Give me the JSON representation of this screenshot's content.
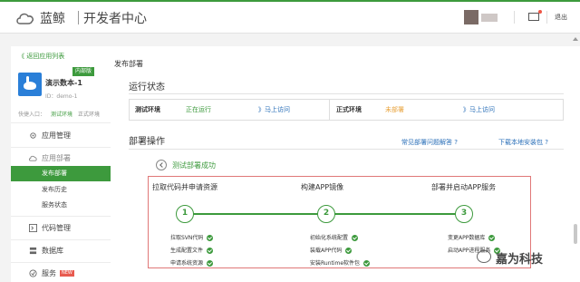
{
  "header": {
    "brand": "蓝鲸",
    "subtitle": "开发者中心",
    "logout": "退出",
    "icons": [
      "cloud-logo-icon",
      "avatar",
      "mail-icon"
    ]
  },
  "sidebar": {
    "back_link": "《 返回应用列表",
    "app": {
      "badge": "内部版",
      "name": "演示数本-1",
      "id": "ID：demo-1"
    },
    "quick_entry": {
      "label": "快捷入口：",
      "test_env": "测试环境",
      "prod_env": "正式环境"
    },
    "menu": {
      "app_manage": "应用管理",
      "app_deploy": "应用部署",
      "deploy_publish": "发布部署",
      "deploy_history": "发布历史",
      "service_status": "服务状态",
      "code_manage": "代码管理",
      "database": "数据库",
      "services": "服务",
      "new_badge": "NEW"
    }
  },
  "main": {
    "page_title": "发布部署",
    "run_status": {
      "title": "运行状态",
      "test_env_label": "测试环境",
      "test_env_status": "正在运行",
      "test_env_visit": "》马上访问",
      "prod_env_label": "正式环境",
      "prod_env_status": "未部署",
      "prod_env_visit": "》马上访问"
    },
    "deploy_ops": {
      "title": "部署操作",
      "faq_link": "常见部署问题解答 ?",
      "download_link": "下载本地安装包 ?",
      "success_msg": "测试部署成功"
    },
    "steps": [
      {
        "num": "1",
        "title": "拉取代码并申请资源",
        "tasks": [
          "拉取SVN代码",
          "生成配置文件",
          "申请系统资源"
        ]
      },
      {
        "num": "2",
        "title": "构建APP镜像",
        "tasks": [
          "初始化系统配置",
          "装载APP代码",
          "安装Runtime软件包"
        ]
      },
      {
        "num": "3",
        "title": "部署并启动APP服务",
        "tasks": [
          "变更APP数据库",
          "启动APP进程服务"
        ]
      }
    ]
  },
  "watermark": {
    "text": "嘉为科技"
  },
  "colors": {
    "accent": "#3d9a3d",
    "link": "#2a6fb8",
    "warning": "#e8a23a",
    "highlight_border": "#e07878"
  }
}
